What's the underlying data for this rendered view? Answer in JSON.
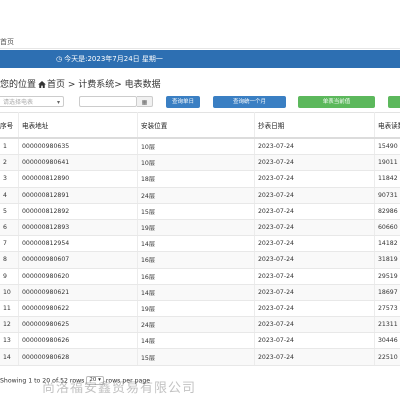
{
  "tab_bar": {
    "home_tab": "首页"
  },
  "banner": {
    "icon": "clock-icon",
    "today_text": "今天是:2023年7月24日 星期一"
  },
  "breadcrumb": {
    "prefix": "您的位置",
    "home_icon": "home-icon",
    "path": "首页 > 计费系统> 电表数据"
  },
  "toolbar": {
    "select_placeholder": "请选择电表",
    "date_value": "",
    "calendar_icon": "calendar-icon",
    "btn_query_day": "查询单日",
    "btn_query_month": "查询统一个月",
    "btn_single_export": "单表当前值",
    "btn_extra": "",
    "colors": {
      "primary": "#3a7fc3",
      "success": "#5cb85c",
      "banner": "#2d6fb2"
    }
  },
  "table": {
    "columns": [
      "序号",
      "电表地址",
      "安装位置",
      "抄表日期",
      "电表读数"
    ],
    "rows": [
      [
        "1",
        "000000980635",
        "10层",
        "2023-07-24",
        "15490"
      ],
      [
        "2",
        "000000980641",
        "10层",
        "2023-07-24",
        "19011"
      ],
      [
        "3",
        "000000812890",
        "18层",
        "2023-07-24",
        "11842"
      ],
      [
        "4",
        "000000812891",
        "24层",
        "2023-07-24",
        "90731"
      ],
      [
        "5",
        "000000812892",
        "15层",
        "2023-07-24",
        "82986"
      ],
      [
        "6",
        "000000812893",
        "19层",
        "2023-07-24",
        "60660"
      ],
      [
        "7",
        "000000812954",
        "14层",
        "2023-07-24",
        "14182"
      ],
      [
        "8",
        "000000980607",
        "16层",
        "2023-07-24",
        "31819"
      ],
      [
        "9",
        "000000980620",
        "16层",
        "2023-07-24",
        "29519"
      ],
      [
        "10",
        "000000980621",
        "14层",
        "2023-07-24",
        "18697"
      ],
      [
        "11",
        "000000980622",
        "19层",
        "2023-07-24",
        "27573"
      ],
      [
        "12",
        "000000980625",
        "24层",
        "2023-07-24",
        "21311"
      ],
      [
        "13",
        "000000980626",
        "14层",
        "2023-07-24",
        "30446"
      ],
      [
        "14",
        "000000980628",
        "15层",
        "2023-07-24",
        "22510"
      ]
    ]
  },
  "footer": {
    "text_before": "Showing 1 to 20 of 52 rows",
    "page_size": "20",
    "text_after": "rows per page"
  },
  "watermark": "尚洛福安鑫贸易有限公司"
}
